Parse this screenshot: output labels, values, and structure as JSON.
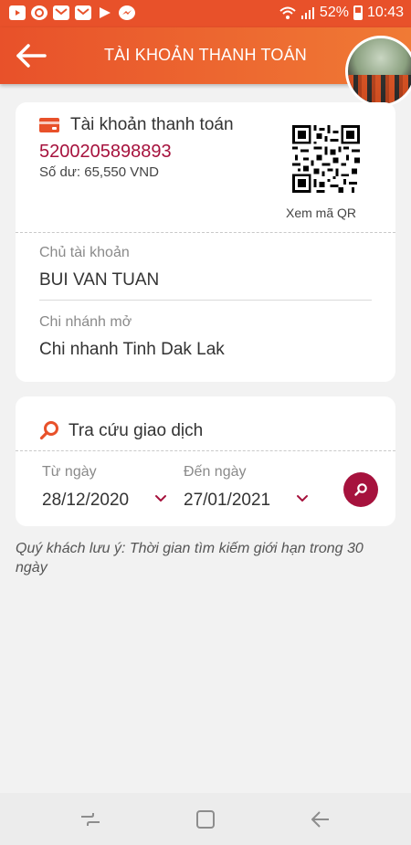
{
  "status_bar": {
    "battery": "52%",
    "time": "10:43",
    "notification_icons": [
      "youtube-icon",
      "app-icon",
      "mail-icon",
      "mail-icon",
      "play-store-icon",
      "messenger-icon"
    ]
  },
  "header": {
    "title": "TÀI KHOẢN THANH TOÁN"
  },
  "account": {
    "title": "Tài khoản thanh toán",
    "number": "5200205898893",
    "balance": "Số dư: 65,550 VND",
    "qr_label": "Xem mã QR",
    "owner_label": "Chủ tài khoản",
    "owner_value": "BUI VAN TUAN",
    "branch_label": "Chi nhánh mở",
    "branch_value": "Chi nhanh Tinh Dak Lak"
  },
  "search": {
    "title": "Tra cứu giao dịch",
    "from_label": "Từ ngày",
    "from_value": "28/12/2020",
    "to_label": "Đến ngày",
    "to_value": "27/01/2021"
  },
  "note": "Quý khách lưu ý: Thời gian tìm kiếm giới hạn trong 30 ngày",
  "colors": {
    "header_start": "#e8512a",
    "header_end": "#f07a35",
    "accent": "#a6123d",
    "icon_orange": "#e8512a"
  }
}
